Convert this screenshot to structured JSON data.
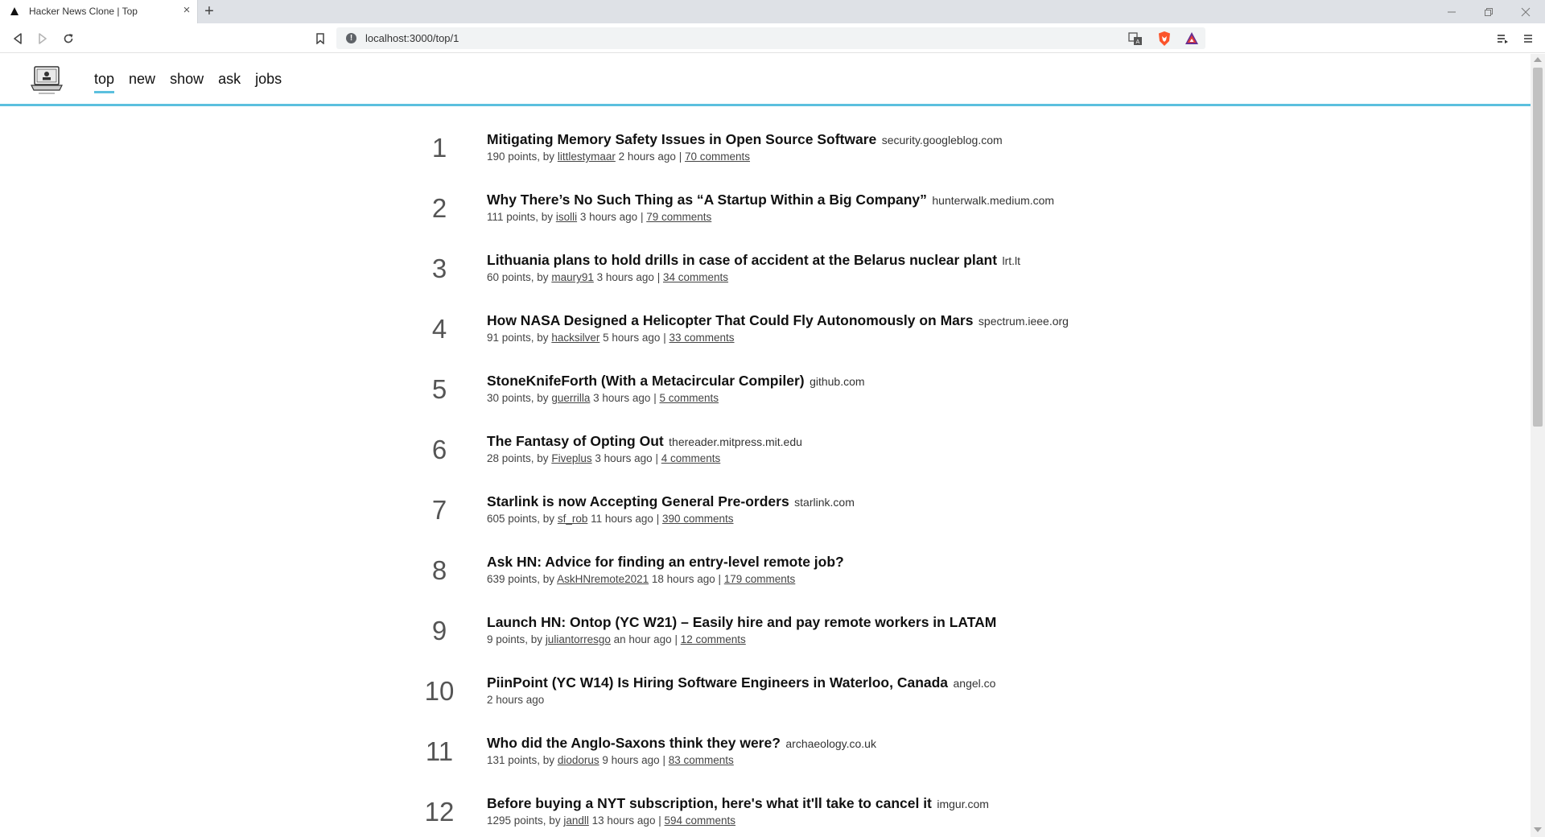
{
  "browser": {
    "tab_title": "Hacker News Clone | Top",
    "url": "localhost:3000/top/1",
    "new_tab_label": "+",
    "tab_close_label": "×"
  },
  "site": {
    "nav": [
      {
        "label": "top",
        "active": true
      },
      {
        "label": "new",
        "active": false
      },
      {
        "label": "show",
        "active": false
      },
      {
        "label": "ask",
        "active": false
      },
      {
        "label": "jobs",
        "active": false
      }
    ],
    "accent_color": "#5bc0de"
  },
  "stories": [
    {
      "rank": "1",
      "title": "Mitigating Memory Safety Issues in Open Source Software",
      "domain": "security.googleblog.com",
      "points": "190 points, by",
      "user": "littlestymaar",
      "time": "2 hours ago",
      "sep": "|",
      "comments": "70 comments"
    },
    {
      "rank": "2",
      "title": "Why There’s No Such Thing as “A Startup Within a Big Company”",
      "domain": "hunterwalk.medium.com",
      "points": "111 points, by",
      "user": "isolli",
      "time": "3 hours ago",
      "sep": "|",
      "comments": "79 comments"
    },
    {
      "rank": "3",
      "title": "Lithuania plans to hold drills in case of accident at the Belarus nuclear plant",
      "domain": "lrt.lt",
      "points": "60 points, by",
      "user": "maury91",
      "time": "3 hours ago",
      "sep": "|",
      "comments": "34 comments"
    },
    {
      "rank": "4",
      "title": "How NASA Designed a Helicopter That Could Fly Autonomously on Mars",
      "domain": "spectrum.ieee.org",
      "points": "91 points, by",
      "user": "hacksilver",
      "time": "5 hours ago",
      "sep": "|",
      "comments": "33 comments"
    },
    {
      "rank": "5",
      "title": "StoneKnifeForth (With a Metacircular Compiler)",
      "domain": "github.com",
      "points": "30 points, by",
      "user": "guerrilla",
      "time": "3 hours ago",
      "sep": "|",
      "comments": "5 comments"
    },
    {
      "rank": "6",
      "title": "The Fantasy of Opting Out",
      "domain": "thereader.mitpress.mit.edu",
      "points": "28 points, by",
      "user": "Fiveplus",
      "time": "3 hours ago",
      "sep": "|",
      "comments": "4 comments"
    },
    {
      "rank": "7",
      "title": "Starlink is now Accepting General Pre-orders",
      "domain": "starlink.com",
      "points": "605 points, by",
      "user": "sf_rob",
      "time": "11 hours ago",
      "sep": "|",
      "comments": "390 comments"
    },
    {
      "rank": "8",
      "title": "Ask HN: Advice for finding an entry-level remote job?",
      "domain": "",
      "points": "639 points, by",
      "user": "AskHNremote2021",
      "time": "18 hours ago",
      "sep": "|",
      "comments": "179 comments"
    },
    {
      "rank": "9",
      "title": "Launch HN: Ontop (YC W21) – Easily hire and pay remote workers in LATAM",
      "domain": "",
      "points": "9 points, by",
      "user": "juliantorresgo",
      "time": "an hour ago",
      "sep": "|",
      "comments": "12 comments"
    },
    {
      "rank": "10",
      "title": "PiinPoint (YC W14) Is Hiring Software Engineers in Waterloo, Canada",
      "domain": "angel.co",
      "points": "",
      "user": "",
      "time": "2 hours ago",
      "sep": "",
      "comments": ""
    },
    {
      "rank": "11",
      "title": "Who did the Anglo-Saxons think they were?",
      "domain": "archaeology.co.uk",
      "points": "131 points, by",
      "user": "diodorus",
      "time": "9 hours ago",
      "sep": "|",
      "comments": "83 comments"
    },
    {
      "rank": "12",
      "title": "Before buying a NYT subscription, here's what it'll take to cancel it",
      "domain": "imgur.com",
      "points": "1295 points, by",
      "user": "jandll",
      "time": "13 hours ago",
      "sep": "|",
      "comments": "594 comments"
    }
  ]
}
